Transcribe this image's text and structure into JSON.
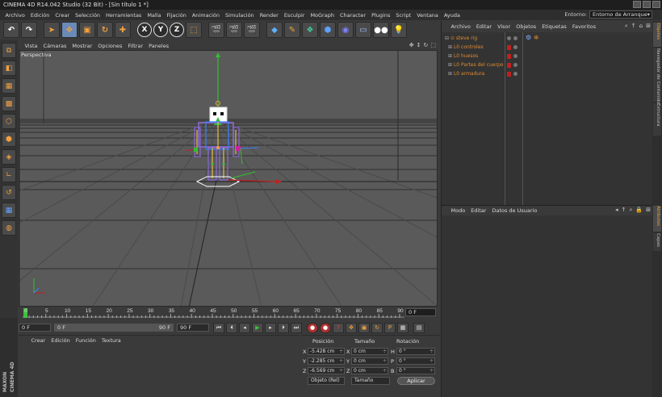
{
  "window": {
    "title": "CINEMA 4D R14.042 Studio (32 Bit) - [Sin título 1 *]"
  },
  "menubar": {
    "items": [
      "Archivo",
      "Edición",
      "Crear",
      "Selección",
      "Herramientas",
      "Malla",
      "Fijación",
      "Animación",
      "Simulación",
      "Render",
      "Esculpir",
      "MoGraph",
      "Character",
      "Plugins",
      "Script",
      "Ventana",
      "Ayuda"
    ],
    "entorno_label": "Entorno:",
    "entorno_value": "Entorno de Arranque"
  },
  "toolbar": {
    "axis_x": "X",
    "axis_y": "Y",
    "axis_z": "Z"
  },
  "viewport": {
    "menu": [
      "Vista",
      "Cámaras",
      "Mostrar",
      "Opciones",
      "Filtrar",
      "Paneles"
    ],
    "label": "Perspectiva"
  },
  "timeline": {
    "ticks": [
      "0",
      "5",
      "10",
      "15",
      "20",
      "25",
      "30",
      "35",
      "40",
      "45",
      "50",
      "55",
      "60",
      "65",
      "70",
      "75",
      "80",
      "85",
      "90"
    ],
    "current_frame": "0 F"
  },
  "playback": {
    "start": "0 F",
    "range_start": "0 F",
    "range_end": "90 F",
    "end": "90 F"
  },
  "materials": {
    "menu": [
      "Crear",
      "Edición",
      "Función",
      "Textura"
    ]
  },
  "brand": {
    "maxon": "MAXON",
    "product": "CINEMA 4D"
  },
  "coordinates": {
    "headers": {
      "position": "Posición",
      "size": "Tamaño",
      "rotation": "Rotación"
    },
    "rows": [
      {
        "axis": "X",
        "pos": "-5.428 cm",
        "size_axis": "X",
        "size": "0 cm",
        "rot_axis": "H",
        "rot": "0 °"
      },
      {
        "axis": "Y",
        "pos": "-2.285 cm",
        "size_axis": "Y",
        "size": "0 cm",
        "rot_axis": "P",
        "rot": "0 °"
      },
      {
        "axis": "Z",
        "pos": "-6.569 cm",
        "size_axis": "Z",
        "size": "0 cm",
        "rot_axis": "B",
        "rot": "0 °"
      }
    ],
    "mode": "Objeto (Rel)",
    "size_mode": "Tamaño",
    "apply": "Aplicar"
  },
  "objects": {
    "menu": [
      "Archivo",
      "Editar",
      "Visor",
      "Objetos",
      "Etiquetas",
      "Favoritos"
    ],
    "root": "steve rig",
    "children": [
      "controles",
      "huesos",
      "Partes del cuerpo",
      "armadura"
    ]
  },
  "attributes": {
    "menu": [
      "Modo",
      "Editar",
      "Datos de Usuario"
    ]
  },
  "right_tabs": {
    "top": [
      "Objetos",
      "Navegador de Contenido",
      "Estructura"
    ],
    "bottom": [
      "Atributos",
      "Capas"
    ]
  }
}
